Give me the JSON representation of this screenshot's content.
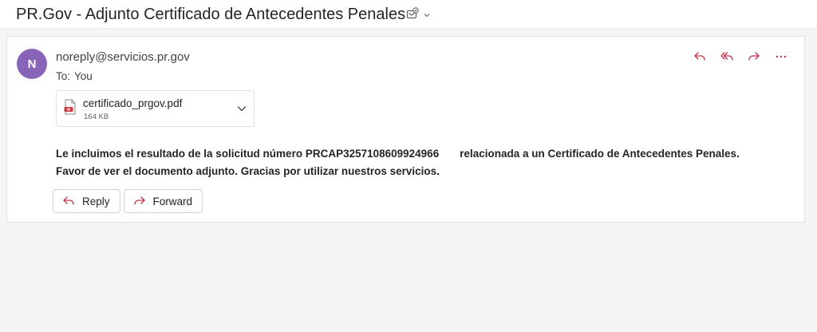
{
  "subject": {
    "title": "PR.Gov - Adjunto Certificado de Antecedentes Penales",
    "tag_icon": "tag-icon",
    "dropdown_icon": "chevron-down-icon"
  },
  "message": {
    "avatar_initial": "N",
    "avatar_color": "#8764b8",
    "sender": "noreply@servicios.pr.gov",
    "to_label": "To:",
    "to_value": "You",
    "actions": [
      {
        "name": "reply",
        "icon": "reply-icon"
      },
      {
        "name": "reply-all",
        "icon": "reply-all-icon"
      },
      {
        "name": "forward",
        "icon": "forward-icon"
      },
      {
        "name": "more",
        "icon": "more-icon"
      }
    ],
    "accent_color": "#c4314b",
    "attachment": {
      "name": "certificado_prgov.pdf",
      "size": "164 KB",
      "icon": "pdf-icon"
    },
    "body_line1_a": "Le incluimos el resultado de la solicitud número PRCAP3257108609924966",
    "body_line1_b": "relacionada a un Certificado de Antecedentes Penales.",
    "body_line2": "Favor de ver el documento adjunto. Gracias por utilizar nuestros servicios.",
    "reply_label": "Reply",
    "forward_label": "Forward"
  }
}
